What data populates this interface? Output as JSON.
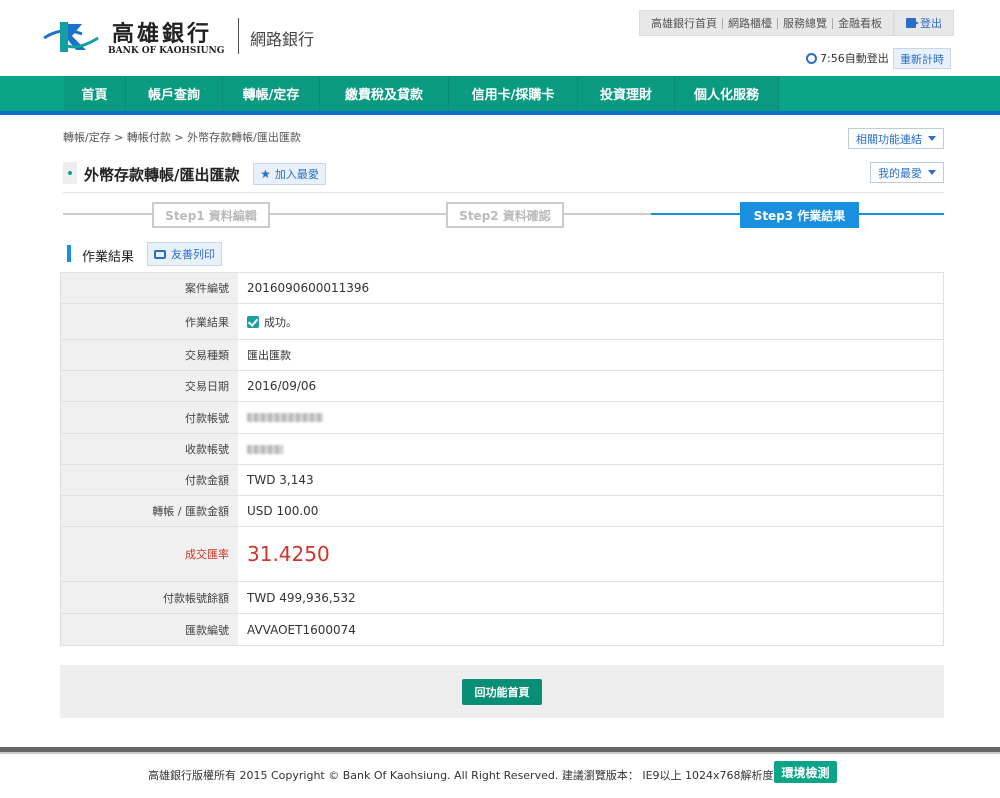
{
  "header": {
    "logo_cn": "高雄銀行",
    "logo_en": "BANK OF KAOHSIUNG",
    "subtitle": "網路銀行",
    "top_links": [
      "高雄銀行首頁",
      "網路櫃檯",
      "服務總覽",
      "金融看板"
    ],
    "logout_label": "登出",
    "timer_text": "7:56自動登出",
    "reset_label": "重新計時"
  },
  "nav": {
    "items": [
      "首頁",
      "帳戶查詢",
      "轉帳/定存",
      "繳費稅及貸款",
      "信用卡/採購卡",
      "投資理財",
      "個人化服務"
    ]
  },
  "breadcrumb": "轉帳/定存 > 轉帳付款 > 外幣存款轉帳/匯出匯款",
  "related_label": "相關功能連結",
  "fav_label": "我的最愛",
  "page_title": "外幣存款轉帳/匯出匯款",
  "add_fav_label": "加入最愛",
  "steps": [
    {
      "label": "Step1 資料編輯",
      "active": false
    },
    {
      "label": "Step2 資料確認",
      "active": false
    },
    {
      "label": "Step3 作業結果",
      "active": true
    }
  ],
  "section": {
    "title": "作業結果",
    "print_label": "友善列印"
  },
  "result": {
    "case_no": {
      "label": "案件編號",
      "value": "2016090600011396"
    },
    "status": {
      "label": "作業結果",
      "value": "成功。"
    },
    "tx_type": {
      "label": "交易種類",
      "value": "匯出匯款"
    },
    "tx_date": {
      "label": "交易日期",
      "value": "2016/09/06"
    },
    "payer_acct": {
      "label": "付款帳號"
    },
    "payee_acct": {
      "label": "收款帳號"
    },
    "pay_amount": {
      "label": "付款金額",
      "value": "TWD 3,143"
    },
    "transfer_amount": {
      "label": "轉帳 / 匯款金額",
      "value": "USD 100.00"
    },
    "rate": {
      "label": "成交匯率",
      "value": "31.4250"
    },
    "balance": {
      "label": "付款帳號餘額",
      "value": "TWD 499,936,532"
    },
    "remit_no": {
      "label": "匯款編號",
      "value": "AVVAOET1600074"
    }
  },
  "home_button_label": "回功能首頁",
  "footer": {
    "text": "高雄銀行版權所有 2015 Copyright © Bank Of Kaohsiung. All Right Reserved. 建議瀏覽版本： IE9以上 1024x768解析度為佳",
    "env_label": "環境檢測"
  },
  "colors": {
    "nav": "#0aa588",
    "accent_blue": "#1a8fe0",
    "rate_red": "#d0342c"
  }
}
